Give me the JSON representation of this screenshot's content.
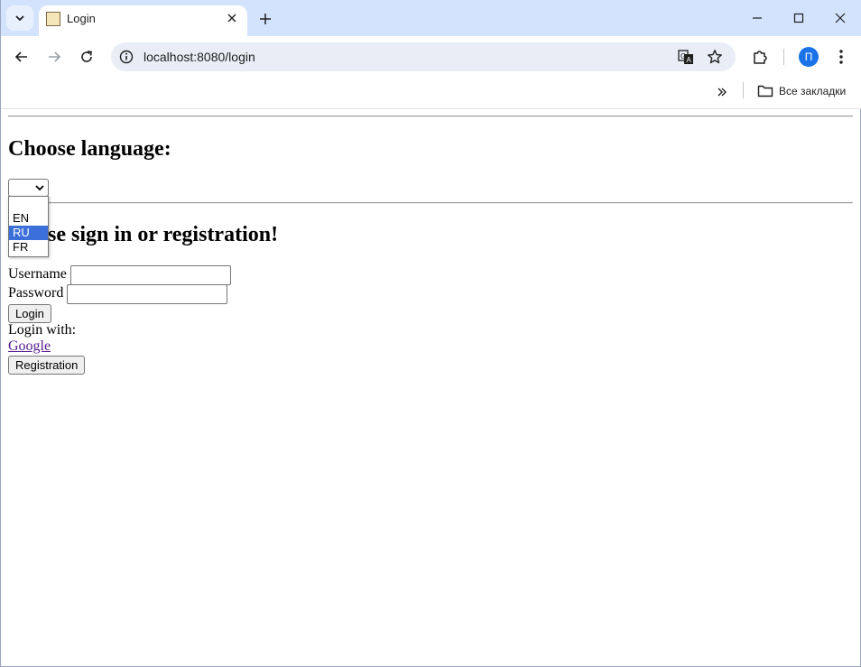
{
  "browser": {
    "tab_title": "Login",
    "url": "localhost:8080/login",
    "profile_initial": "П",
    "bookmarks_all_label": "Все закладки"
  },
  "page": {
    "language_heading": "Choose language:",
    "language_select": {
      "selected": "",
      "options": [
        "",
        "EN",
        "RU",
        "FR"
      ],
      "highlighted": "RU"
    },
    "sign_heading": "Please sign in or registration!",
    "username_label": "Username",
    "password_label": "Password",
    "login_button": "Login",
    "login_with_label": "Login with:",
    "google_link": "Google",
    "registration_button": "Registration"
  },
  "colors": {
    "tabstrip_bg": "#d3e3fd",
    "omnibox_bg": "#e9eef6",
    "dropdown_highlight": "#3b6fd9",
    "visited_link": "#551a8b"
  }
}
